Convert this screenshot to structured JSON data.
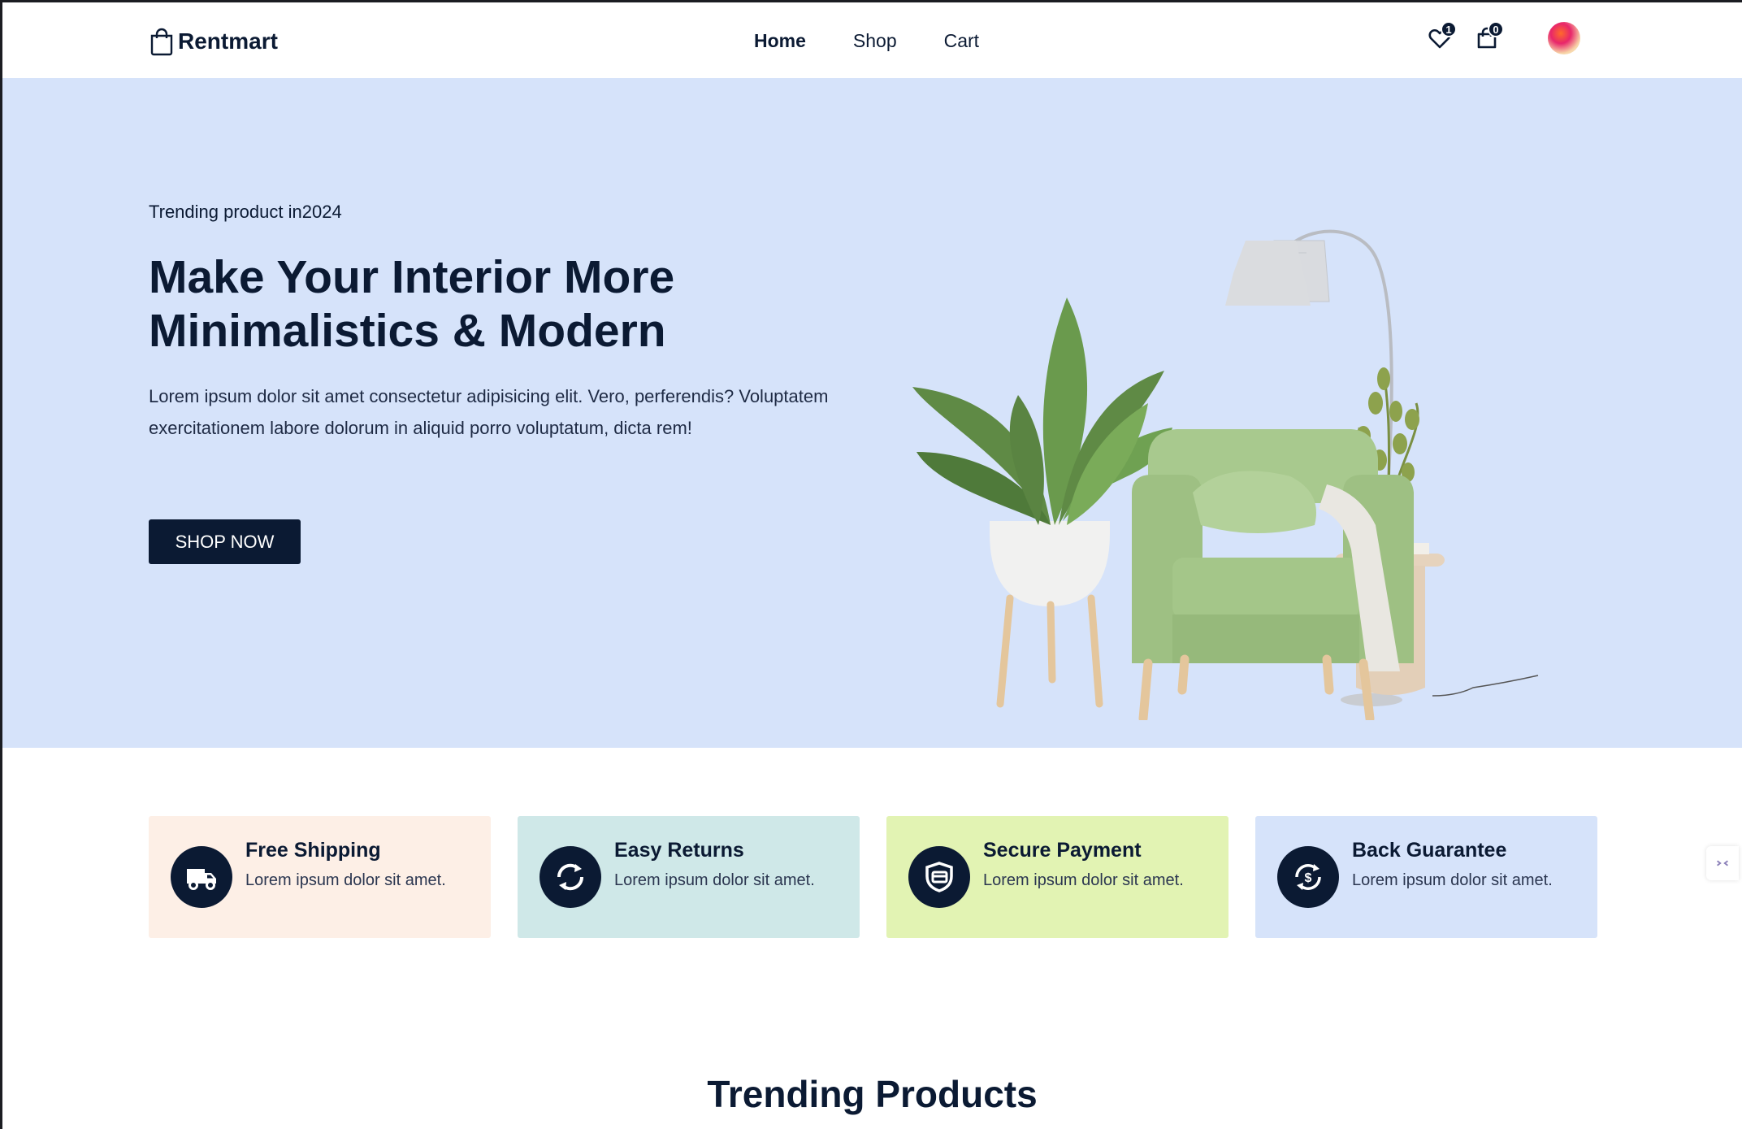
{
  "brand": {
    "name": "Rentmart",
    "logo_icon": "shopping-bag-icon"
  },
  "nav": {
    "links": [
      {
        "label": "Home",
        "active": true
      },
      {
        "label": "Shop",
        "active": false
      },
      {
        "label": "Cart",
        "active": false
      }
    ],
    "wishlist": {
      "icon": "heart-icon",
      "count": "1"
    },
    "cart": {
      "icon": "bag-icon",
      "count": "0"
    },
    "avatar": {
      "icon": "user-avatar"
    }
  },
  "hero": {
    "tag": "Trending product in2024",
    "title_line1": "Make Your Interior More",
    "title_line2": "Minimalistics & Modern",
    "description": "Lorem ipsum dolor sit amet consectetur adipisicing elit. Vero, perferendis? Voluptatem exercitationem labore dolorum in aliquid porro voluptatum, dicta rem!",
    "cta_label": "SHOP NOW",
    "background": "#d6e3fa"
  },
  "features": [
    {
      "title": "Free Shipping",
      "text": "Lorem ipsum dolor sit amet.",
      "icon": "truck-icon",
      "bg": "#fdefe6"
    },
    {
      "title": "Easy Returns",
      "text": "Lorem ipsum dolor sit amet.",
      "icon": "refresh-icon",
      "bg": "#cfe8e8"
    },
    {
      "title": "Secure Payment",
      "text": "Lorem ipsum dolor sit amet.",
      "icon": "shield-icon",
      "bg": "#e2f3b3"
    },
    {
      "title": "Back Guarantee",
      "text": "Lorem ipsum dolor sit amet.",
      "icon": "money-back-icon",
      "bg": "#d6e3fa"
    }
  ],
  "sections": {
    "trending_title": "Trending Products"
  },
  "colors": {
    "primary": "#0b1a33",
    "accent_hero": "#d6e3fa"
  }
}
